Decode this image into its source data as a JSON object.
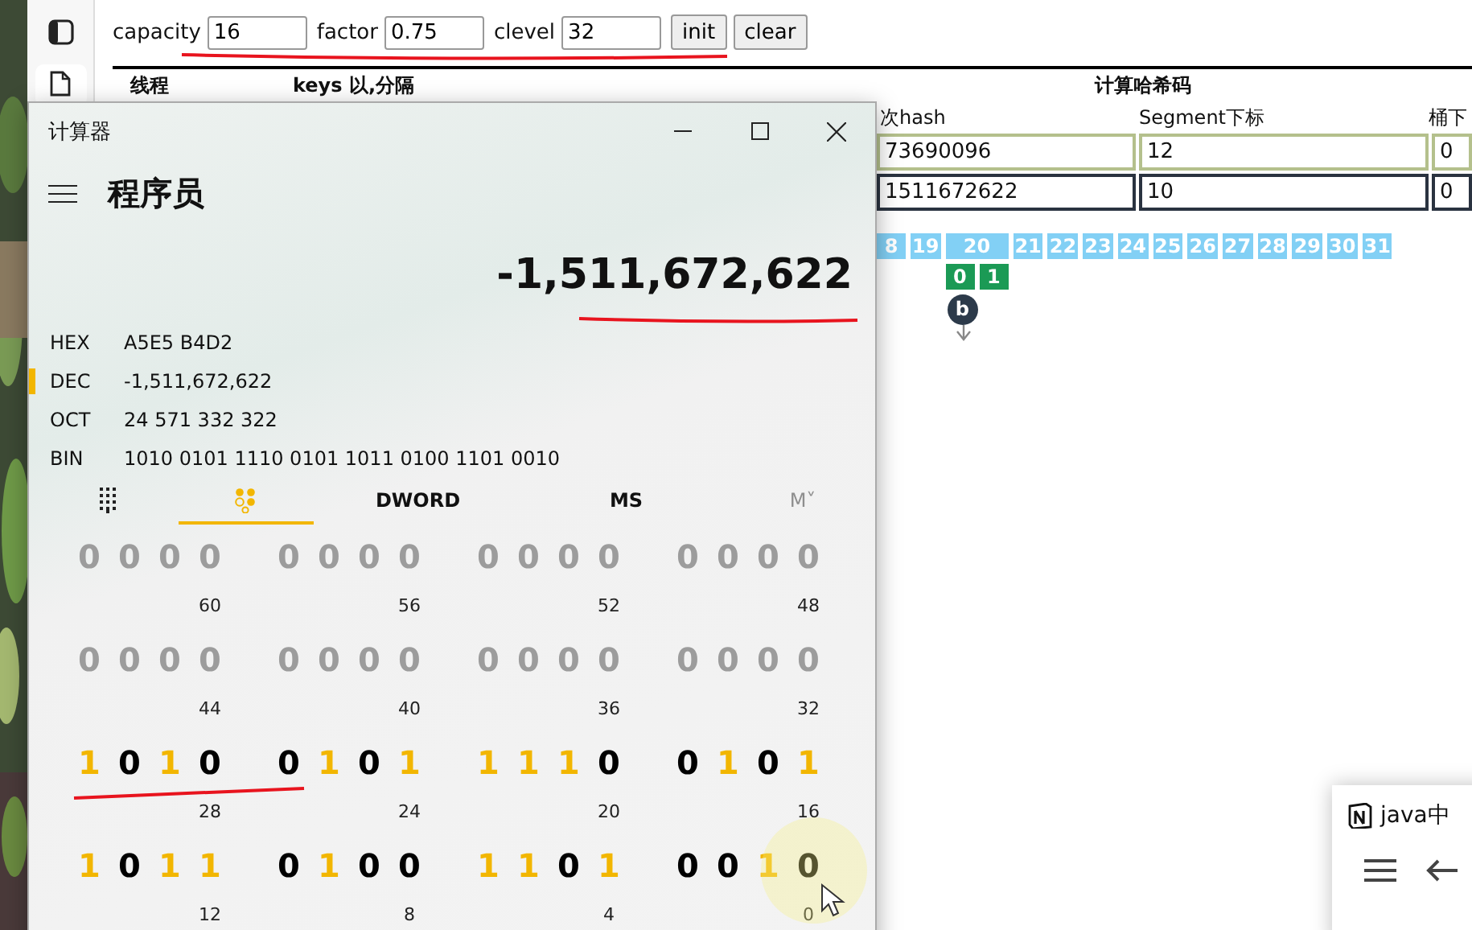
{
  "toolbar": {
    "fields": [
      {
        "label": "capacity",
        "value": "16"
      },
      {
        "label": "factor",
        "value": "0.75"
      },
      {
        "label": "clevel",
        "value": "32"
      }
    ],
    "buttons": [
      "init",
      "clear"
    ]
  },
  "table": {
    "group_headers": [
      "线程",
      "keys 以,分隔",
      "计算哈希码"
    ],
    "columns": [
      "次hash",
      "Segment下标",
      "桶下"
    ],
    "rows": [
      {
        "cells": [
          "73690096",
          "12",
          "0"
        ],
        "highlighted": true
      },
      {
        "cells": [
          "1511672622",
          "10",
          "0"
        ],
        "highlighted": false
      }
    ]
  },
  "buckets": [
    {
      "label": "8"
    },
    {
      "label": "19"
    },
    {
      "label": "20",
      "entries": [
        "0",
        "1"
      ],
      "node": "b"
    },
    {
      "label": "21"
    },
    {
      "label": "22"
    },
    {
      "label": "23"
    },
    {
      "label": "24"
    },
    {
      "label": "25"
    },
    {
      "label": "26"
    },
    {
      "label": "27"
    },
    {
      "label": "28"
    },
    {
      "label": "29"
    },
    {
      "label": "30"
    },
    {
      "label": "31"
    }
  ],
  "calculator": {
    "title": "计算器",
    "mode": "程序员",
    "display": "-1,511,672,622",
    "radix": [
      {
        "label": "HEX",
        "value": "A5E5 B4D2",
        "selected": false
      },
      {
        "label": "DEC",
        "value": "-1,511,672,622",
        "selected": true
      },
      {
        "label": "OCT",
        "value": "24 571 332 322",
        "selected": false
      },
      {
        "label": "BIN",
        "value": "1010 0101 1110 0101 1011 0100 1101 0010",
        "selected": false
      }
    ],
    "tabs": [
      {
        "kind": "keypad",
        "selected": false,
        "disabled": false
      },
      {
        "kind": "bits",
        "selected": true,
        "disabled": false
      },
      {
        "kind": "text",
        "label": "DWORD",
        "selected": false,
        "disabled": false
      },
      {
        "kind": "text",
        "label": "MS",
        "selected": false,
        "disabled": false
      },
      {
        "kind": "text",
        "label": "M˅",
        "selected": false,
        "disabled": true
      }
    ],
    "bit_rows": [
      [
        {
          "label": "60",
          "disabled": true,
          "bits": [
            {
              "digit": "0"
            },
            {
              "digit": "0"
            },
            {
              "digit": "0"
            },
            {
              "digit": "0"
            }
          ]
        },
        {
          "label": "56",
          "disabled": true,
          "bits": [
            {
              "digit": "0"
            },
            {
              "digit": "0"
            },
            {
              "digit": "0"
            },
            {
              "digit": "0"
            }
          ]
        },
        {
          "label": "52",
          "disabled": true,
          "bits": [
            {
              "digit": "0"
            },
            {
              "digit": "0"
            },
            {
              "digit": "0"
            },
            {
              "digit": "0"
            }
          ]
        },
        {
          "label": "48",
          "disabled": true,
          "bits": [
            {
              "digit": "0"
            },
            {
              "digit": "0"
            },
            {
              "digit": "0"
            },
            {
              "digit": "0"
            }
          ]
        }
      ],
      [
        {
          "label": "44",
          "disabled": true,
          "bits": [
            {
              "digit": "0"
            },
            {
              "digit": "0"
            },
            {
              "digit": "0"
            },
            {
              "digit": "0"
            }
          ]
        },
        {
          "label": "40",
          "disabled": true,
          "bits": [
            {
              "digit": "0"
            },
            {
              "digit": "0"
            },
            {
              "digit": "0"
            },
            {
              "digit": "0"
            }
          ]
        },
        {
          "label": "36",
          "disabled": true,
          "bits": [
            {
              "digit": "0"
            },
            {
              "digit": "0"
            },
            {
              "digit": "0"
            },
            {
              "digit": "0"
            }
          ]
        },
        {
          "label": "32",
          "disabled": true,
          "bits": [
            {
              "digit": "0"
            },
            {
              "digit": "0"
            },
            {
              "digit": "0"
            },
            {
              "digit": "0"
            }
          ]
        }
      ],
      [
        {
          "label": "28",
          "disabled": false,
          "bits": [
            {
              "digit": "1",
              "on": true
            },
            {
              "digit": "0",
              "on": false
            },
            {
              "digit": "1",
              "on": true
            },
            {
              "digit": "0",
              "on": false
            }
          ]
        },
        {
          "label": "24",
          "disabled": false,
          "bits": [
            {
              "digit": "0",
              "on": false
            },
            {
              "digit": "1",
              "on": true
            },
            {
              "digit": "0",
              "on": false
            },
            {
              "digit": "1",
              "on": true
            }
          ]
        },
        {
          "label": "20",
          "disabled": false,
          "bits": [
            {
              "digit": "1",
              "on": true
            },
            {
              "digit": "1",
              "on": true
            },
            {
              "digit": "1",
              "on": true
            },
            {
              "digit": "0",
              "on": false
            }
          ]
        },
        {
          "label": "16",
          "disabled": false,
          "bits": [
            {
              "digit": "0",
              "on": false
            },
            {
              "digit": "1",
              "on": true
            },
            {
              "digit": "0",
              "on": false
            },
            {
              "digit": "1",
              "on": true
            }
          ]
        }
      ],
      [
        {
          "label": "12",
          "disabled": false,
          "bits": [
            {
              "digit": "1",
              "on": true
            },
            {
              "digit": "0",
              "on": false
            },
            {
              "digit": "1",
              "on": true
            },
            {
              "digit": "1",
              "on": true
            }
          ]
        },
        {
          "label": "8",
          "disabled": false,
          "bits": [
            {
              "digit": "0",
              "on": false
            },
            {
              "digit": "1",
              "on": true
            },
            {
              "digit": "0",
              "on": false
            },
            {
              "digit": "0",
              "on": false
            }
          ]
        },
        {
          "label": "4",
          "disabled": false,
          "bits": [
            {
              "digit": "1",
              "on": true
            },
            {
              "digit": "1",
              "on": true
            },
            {
              "digit": "0",
              "on": false
            },
            {
              "digit": "1",
              "on": true
            }
          ]
        },
        {
          "label": "0",
          "disabled": false,
          "bits": [
            {
              "digit": "0",
              "on": false
            },
            {
              "digit": "0",
              "on": false
            },
            {
              "digit": "1",
              "on": true
            },
            {
              "digit": "0",
              "on": false
            }
          ]
        }
      ]
    ]
  },
  "notification": {
    "title": "java中"
  }
}
